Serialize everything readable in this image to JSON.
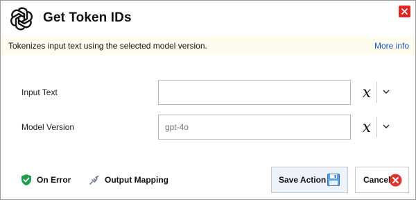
{
  "header": {
    "title": "Get Token IDs",
    "logo_icon": "openai-logo-icon",
    "close_icon": "close-icon"
  },
  "infobar": {
    "description": "Tokenizes input text using the selected model version.",
    "more_info_label": "More info"
  },
  "form": {
    "input_text": {
      "label": "Input Text",
      "value": ""
    },
    "model_version": {
      "label": "Model Version",
      "value": "",
      "placeholder": "gpt-4o"
    },
    "variable_symbol": "x"
  },
  "footer": {
    "on_error_label": "On Error",
    "output_mapping_label": "Output Mapping",
    "save_label": "Save Action",
    "cancel_label": "Cancel"
  },
  "colors": {
    "accent": "#1a56c8",
    "close_red": "#e02424",
    "infobar_bg": "#fdfcec",
    "save_bg": "#eef3fb",
    "shield_green": "#1e9e4a"
  }
}
